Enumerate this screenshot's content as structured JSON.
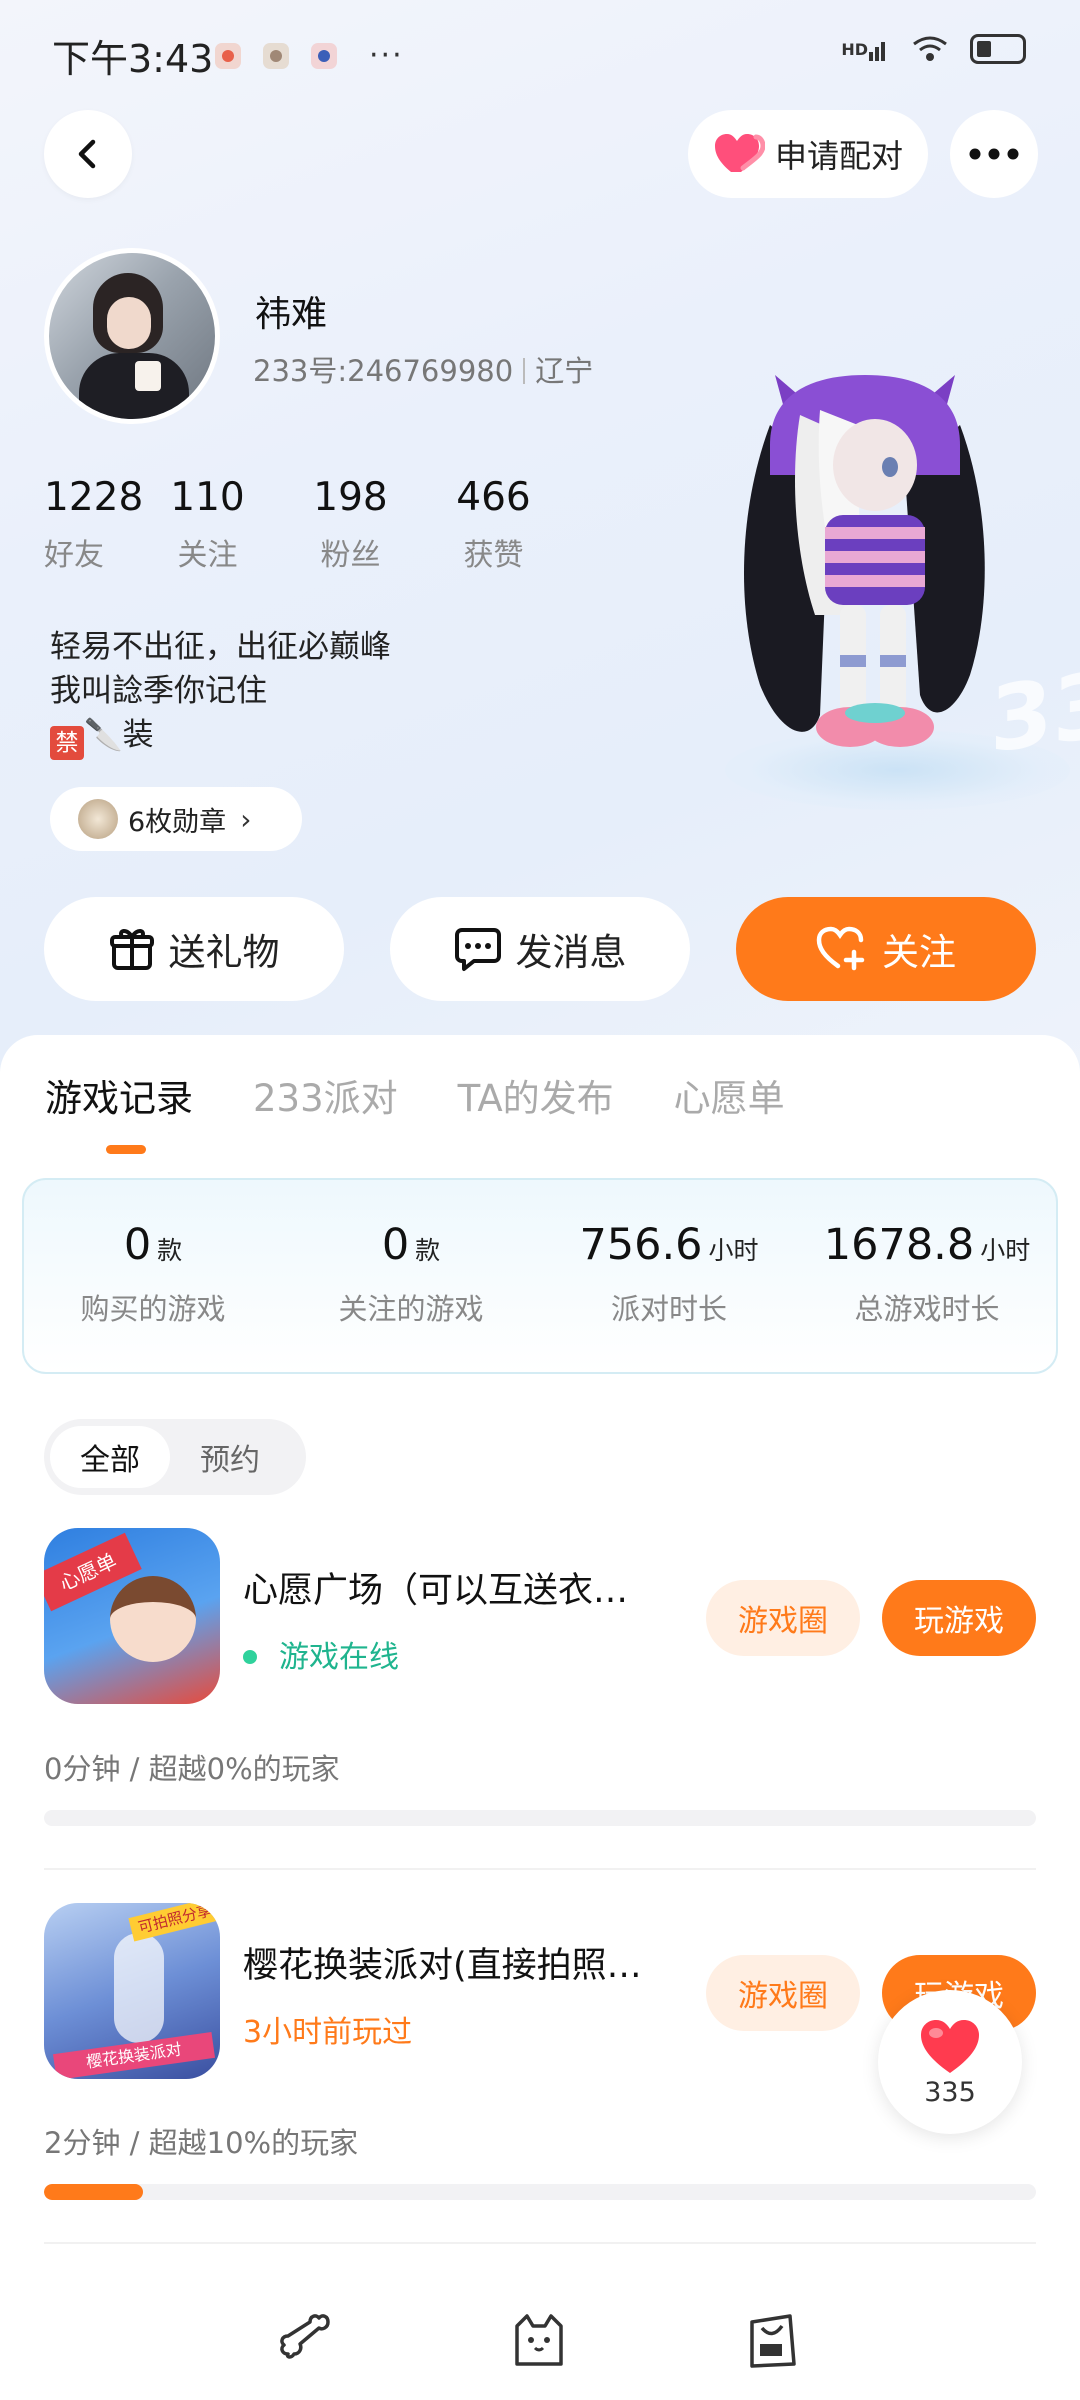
{
  "status_bar": {
    "time": "下午3:43",
    "more": "···",
    "network": "HD",
    "battery": "31"
  },
  "header": {
    "pair_label": "申请配对"
  },
  "profile": {
    "name": "祎难",
    "uid": "233号:246769980",
    "region": "辽宁",
    "stats": [
      {
        "value": "1228",
        "label": "好友"
      },
      {
        "value": "110",
        "label": "关注"
      },
      {
        "value": "198",
        "label": "粉丝"
      },
      {
        "value": "466",
        "label": "获赞"
      }
    ],
    "bio_line1": "轻易不出征，出征必巅峰",
    "bio_line2": "我叫諗季你记住",
    "bio_ban": "禁",
    "bio_line3_suffix": "🔪装",
    "badge_label": "6枚勋章"
  },
  "actions": {
    "gift": "送礼物",
    "message": "发消息",
    "follow": "关注"
  },
  "tabs": [
    "游戏记录",
    "233派对",
    "TA的发布",
    "心愿单"
  ],
  "summary": [
    {
      "value": "0",
      "unit": "款",
      "label": "购买的游戏"
    },
    {
      "value": "0",
      "unit": "款",
      "label": "关注的游戏"
    },
    {
      "value": "756.6",
      "unit": "小时",
      "label": "派对时长"
    },
    {
      "value": "1678.8",
      "unit": "小时",
      "label": "总游戏时长"
    }
  ],
  "filter": [
    "全部",
    "预约"
  ],
  "games": [
    {
      "title": "心愿广场（可以互送衣…",
      "status": "游戏在线",
      "circle_label": "游戏圈",
      "play_label": "玩游戏",
      "meta": "0分钟 / 超越0%的玩家",
      "icon_ribbon": "心愿单",
      "progress": 0
    },
    {
      "title": "樱花换装派对(直接拍照…",
      "status": "3小时前玩过",
      "circle_label": "游戏圈",
      "play_label": "玩游戏",
      "meta": "2分钟 / 超越10%的玩家",
      "icon_tag": "可拍照分享",
      "icon_strip": "樱花换装派对",
      "progress": 0.1
    }
  ],
  "like_count": "335",
  "colors": {
    "accent": "#ff7a1a",
    "online": "#1fb48e"
  },
  "icons": [
    "back-arrow-icon",
    "heart-icon",
    "more-dots-icon",
    "gift-icon",
    "chat-bubble-icon",
    "heart-plus-icon",
    "bone-icon",
    "cat-icon",
    "shop-bag-icon"
  ]
}
